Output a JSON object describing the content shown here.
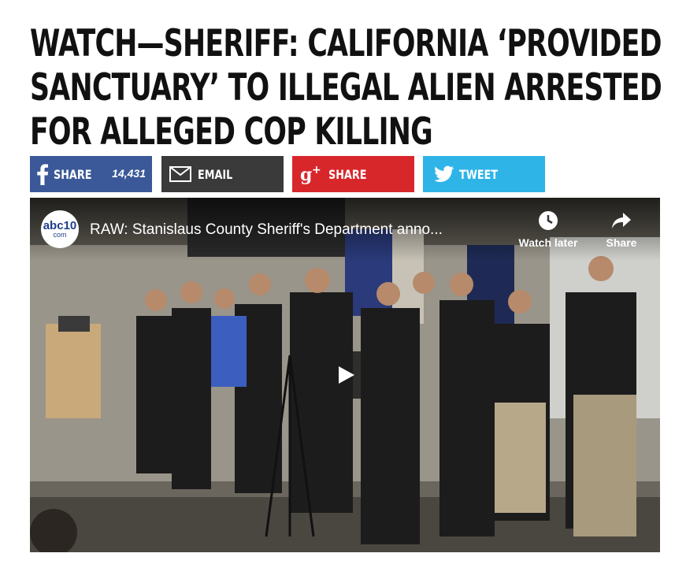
{
  "article": {
    "headline_lines": [
      "WATCH—SHERIFF: CALIFORNIA ‘PROVIDED",
      "SANCTUARY’ TO ILLEGAL ALIEN ARRESTED",
      "FOR ALLEGED COP KILLING"
    ]
  },
  "share": {
    "facebook": {
      "label": "SHARE",
      "count": "14,431",
      "icon": "facebook-icon",
      "color": "#3b5998"
    },
    "email": {
      "label": "EMAIL",
      "icon": "envelope-icon",
      "color": "#3a3a3a"
    },
    "google_plus": {
      "label": "SHARE",
      "icon": "google-plus-icon",
      "color": "#d8272b"
    },
    "twitter": {
      "label": "TWEET",
      "icon": "twitter-bird-icon",
      "color": "#2fb4e8"
    }
  },
  "video": {
    "channel_logo": {
      "top": "abc10",
      "bottom": "com"
    },
    "title": "RAW: Stanislaus County Sheriff's Department anno...",
    "watch_later": "Watch later",
    "share": "Share",
    "play_icon": "play-icon"
  }
}
